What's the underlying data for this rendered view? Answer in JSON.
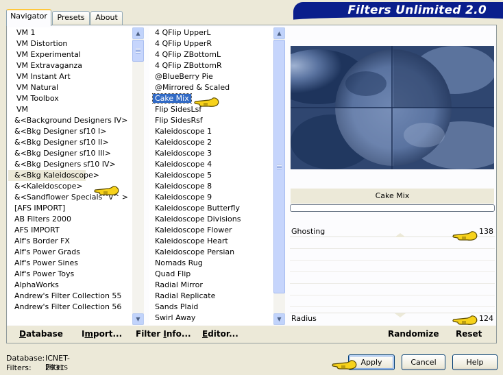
{
  "window": {
    "banner_title": "Filters Unlimited 2.0"
  },
  "tabs": [
    "Navigator",
    "Presets",
    "About"
  ],
  "categories": [
    "VM 1",
    "VM Distortion",
    "VM Experimental",
    "VM Extravaganza",
    "VM Instant Art",
    "VM Natural",
    "VM Toolbox",
    "VM",
    "&<Background Designers IV>",
    "&<Bkg Designer sf10 I>",
    "&<Bkg Designer sf10 II>",
    "&<Bkg Designer sf10 III>",
    "&<Bkg Designers sf10 IV>",
    "&<Bkg Kaleidoscope>",
    "&<Kaleidoscope>",
    "&<Sandflower Specials^v^ >",
    "[AFS IMPORT]",
    "AB Filters 2000",
    "AFS IMPORT",
    "Alf's Border FX",
    "Alf's Power Grads",
    "Alf's Power Sines",
    "Alf's Power Toys",
    "AlphaWorks",
    "Andrew's Filter Collection 55",
    "Andrew's Filter Collection 56"
  ],
  "filters": [
    "4 QFlip UpperL",
    "4 QFlip UpperR",
    "4 QFlip ZBottomL",
    "4 QFlip ZBottomR",
    "@BlueBerry Pie",
    "@Mirrored & Scaled",
    "Cake Mix",
    "Flip SidesLsf",
    "Flip SidesRsf",
    "Kaleidoscope 1",
    "Kaleidoscope 2",
    "Kaleidoscope 3",
    "Kaleidoscope 4",
    "Kaleidoscope 5",
    "Kaleidoscope 8",
    "Kaleidoscope 9",
    "Kaleidoscope Butterfly",
    "Kaleidoscope Divisions",
    "Kaleidoscope Flower",
    "Kaleidoscope Heart",
    "Kaleidoscope Persian",
    "Nomads Rug",
    "Quad Flip",
    "Radial Mirror",
    "Radial Replicate",
    "Sands Plaid",
    "Swirl Away"
  ],
  "selected_filter_name": "Cake Mix",
  "params": [
    {
      "label": "Ghosting",
      "value": "138"
    },
    {
      "label": "Radius",
      "value": "124"
    }
  ],
  "bottom_buttons": {
    "database": {
      "u": "D",
      "rest": "atabase"
    },
    "import": {
      "pre": "I",
      "u": "m",
      "rest": "port..."
    },
    "filter_info": {
      "pre": "Filter ",
      "u": "I",
      "rest": "nfo..."
    },
    "editor": {
      "u": "E",
      "rest": "ditor..."
    },
    "randomize": "Randomize",
    "reset": "Reset"
  },
  "status": {
    "database_label": "Database:",
    "database_value": "ICNET-Filters",
    "filters_label": "Filters:",
    "filters_value": "2931"
  },
  "dialog_buttons": {
    "apply": "Apply",
    "cancel": "Cancel",
    "help": "Help"
  },
  "icons": [
    "pointing-hand-icon",
    "scroll-up-icon",
    "scroll-down-icon"
  ],
  "colors": {
    "banner": "#0a1e8c",
    "selection": "#316ac5",
    "pointer_hand": "#f7d21a",
    "preview_dark": "#1e345c",
    "preview_light": "#8ba0c6"
  }
}
